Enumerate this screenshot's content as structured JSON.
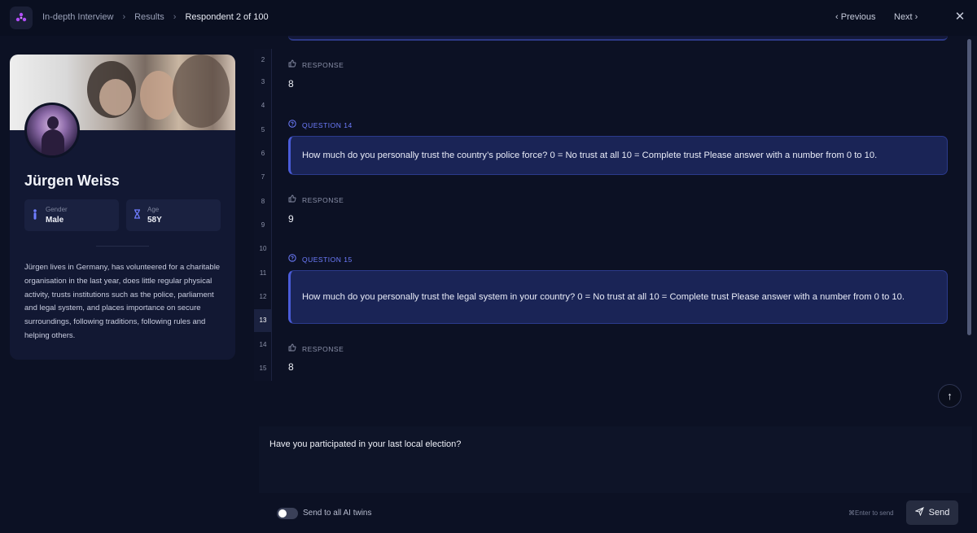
{
  "header": {
    "breadcrumb": [
      "In-depth Interview",
      "Results",
      "Respondent 2 of 100"
    ],
    "previous_label": "Previous",
    "next_label": "Next",
    "close_icon": "close-icon"
  },
  "profile": {
    "name": "Jürgen Weiss",
    "gender_label": "Gender",
    "gender_value": "Male",
    "age_label": "Age",
    "age_value": "58Y",
    "bio": "Jürgen lives in Germany, has volunteered for a charitable organisation in the last year, does little regular physical activity, trusts institutions such as the police, parliament and legal system, and places importance on secure surroundings, following traditions, following rules and helping others."
  },
  "line_numbers": [
    "2",
    "3",
    "4",
    "5",
    "6",
    "7",
    "8",
    "9",
    "10",
    "11",
    "12",
    "13",
    "14",
    "15"
  ],
  "active_line": "13",
  "transcript": {
    "response_label": "RESPONSE",
    "answer_1": "8",
    "question_14_label": "QUESTION 14",
    "question_14_text": "How much do you personally trust the country’s police force? 0 = No trust at all 10 = Complete trust Please answer with a number from 0 to 10.",
    "answer_2": "9",
    "question_15_label": "QUESTION 15",
    "question_15_text": "How much do you personally trust the legal system in your country? 0 = No trust at all 10 = Complete trust Please answer with a number from 0 to 10.",
    "answer_3": "8"
  },
  "composer": {
    "message": "Have you participated in your last local election?",
    "toggle_label": "Send to all AI twins",
    "toggle_on": false,
    "hint": "⌘Enter to send",
    "send_label": "Send"
  },
  "colors": {
    "background": "#0c1124",
    "accent": "#6e7dff",
    "question_box": "#1a2456"
  }
}
